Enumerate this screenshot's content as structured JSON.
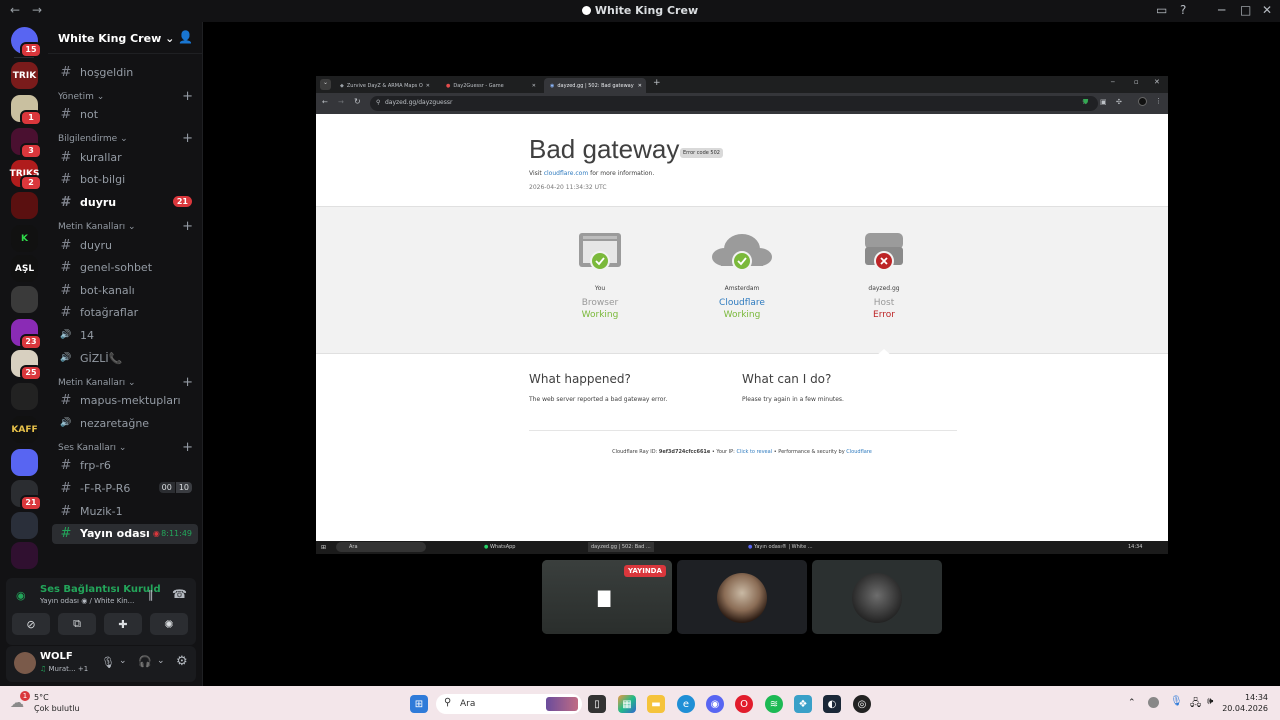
{
  "window": {
    "title": "White King Crew"
  },
  "servers": [
    {
      "label": "",
      "badge": "15",
      "color": "#5865f2",
      "icon": "discord-home-icon"
    },
    {
      "label": "TRIK",
      "badge": "",
      "color": "#7a1b1b"
    },
    {
      "label": "",
      "badge": "1",
      "color": "#c9c0a0"
    },
    {
      "label": "",
      "badge": "3",
      "color": "#4a1030"
    },
    {
      "label": "TRIKS",
      "badge": "2",
      "color": "#b01c1c"
    },
    {
      "label": "",
      "badge": "",
      "color": "#5a1010"
    },
    {
      "label": "K",
      "badge": "",
      "color": "#111",
      "fg": "#2fdc4a"
    },
    {
      "label": "AŞL",
      "badge": "",
      "color": "#111"
    },
    {
      "label": "",
      "badge": "",
      "color": "#3a3a3a"
    },
    {
      "label": "",
      "badge": "23",
      "color": "#8a2bb5"
    },
    {
      "label": "",
      "badge": "25",
      "color": "#d8d0c0"
    },
    {
      "label": "",
      "badge": "",
      "color": "#222"
    },
    {
      "label": "KAFF",
      "badge": "",
      "color": "#111",
      "fg": "#e8c24a"
    },
    {
      "label": "",
      "badge": "",
      "color": "#5865f2",
      "icon": "folder-icon"
    },
    {
      "label": "",
      "badge": "21",
      "color": "#2b2d31"
    },
    {
      "label": "",
      "badge": "",
      "color": "#2a2f3a"
    },
    {
      "label": "",
      "badge": "",
      "color": "#301030"
    }
  ],
  "sidebar": {
    "server_name": "White King Crew",
    "channels_top": [
      {
        "name": "hoşgeldin"
      }
    ],
    "categories": [
      {
        "name": "Yönetim",
        "channels": [
          {
            "name": "not"
          }
        ]
      },
      {
        "name": "Bilgilendirme",
        "channels": [
          {
            "name": "kurallar"
          },
          {
            "name": "bot-bilgi"
          },
          {
            "name": "duyru",
            "badge": "21"
          }
        ]
      },
      {
        "name": "Metin Kanalları",
        "channels": [
          {
            "name": "duyru"
          },
          {
            "name": "genel-sohbet"
          },
          {
            "name": "bot-kanalı"
          },
          {
            "name": "fotağraflar"
          },
          {
            "name": "14"
          },
          {
            "name": "GİZLİ📞"
          }
        ]
      },
      {
        "name": "Metin Kanalları",
        "channels": [
          {
            "name": "mapus-mektupları"
          },
          {
            "name": "nezaretağne"
          }
        ]
      },
      {
        "name": "Ses Kanalları",
        "channels": [
          {
            "name": "frp-r6"
          },
          {
            "name": "-F-R-P-R6",
            "counts": [
              "00",
              "10"
            ]
          },
          {
            "name": "Muzik-1"
          },
          {
            "name": "Yayın odası",
            "timer": "8:11:49"
          }
        ]
      }
    ]
  },
  "voice": {
    "status": "Ses Bağlantısı Kuruld",
    "channel": "Yayın odası",
    "server": "/ White Kin..."
  },
  "user": {
    "name": "WOLF",
    "status": "Murat...",
    "extra": "+1"
  },
  "browser": {
    "tabs": [
      {
        "title": "Zurvive DayZ & ARMA Maps O"
      },
      {
        "title": "Day2Guessr - Game"
      },
      {
        "title": "dayzed.gg | 502: Bad gateway"
      }
    ],
    "address": "dayzed.gg/dayzguessr",
    "page": {
      "title": "Bad gateway",
      "code": "Error code 502",
      "visit_prefix": "Visit",
      "visit_link": "cloudflare.com",
      "visit_suffix": "for more information.",
      "timestamp": "2026-04-20 11:34:32 UTC",
      "nodes": [
        {
          "label": "You",
          "kind": "Browser",
          "status": "Working",
          "ok": true
        },
        {
          "label": "Amsterdam",
          "kind": "Cloudflare",
          "status": "Working",
          "ok": true
        },
        {
          "label": "dayzed.gg",
          "kind": "Host",
          "status": "Error",
          "ok": false
        }
      ],
      "what_happened_title": "What happened?",
      "what_happened_text": "The web server reported a bad gateway error.",
      "what_do_title": "What can I do?",
      "what_do_text": "Please try again in a few minutes.",
      "ray_prefix": "Cloudflare Ray ID:",
      "ray_id": "9ef3d724cfcc661e",
      "ip_prefix": "• Your IP:",
      "ip_link": "Click to reveal",
      "perf": "• Performance & security by",
      "perf_link": "Cloudflare"
    },
    "inner_taskbar": {
      "search": "Ara",
      "whatsapp": "WhatsApp",
      "tab": "dayzed.gg | 502: Bad ...",
      "discord": "Yayın odası® | White ...",
      "time": "14:34"
    }
  },
  "streams": {
    "live_badge": "YAYINDA"
  },
  "taskbar": {
    "temp": "5°C",
    "weather": "Çok bulutlu",
    "search": "Ara",
    "time": "14:34",
    "date": "20.04.2026"
  },
  "colors": {
    "ok": "#7bb93b",
    "err": "#bd2426",
    "link": "#2f7bbf",
    "discord_red": "#da373c"
  }
}
